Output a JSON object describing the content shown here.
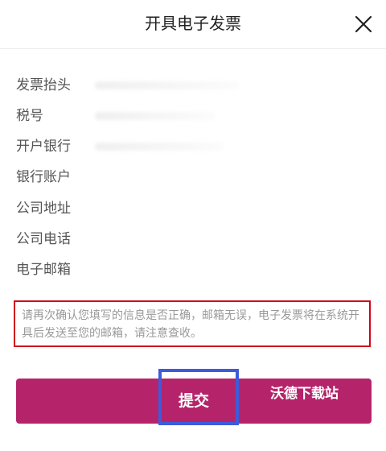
{
  "header": {
    "title": "开具电子发票",
    "close_icon": "close-icon"
  },
  "fields": [
    {
      "label": "发票抬头"
    },
    {
      "label": "税号"
    },
    {
      "label": "开户银行"
    },
    {
      "label": "银行账户"
    },
    {
      "label": "公司地址"
    },
    {
      "label": "公司电话"
    },
    {
      "label": "电子邮箱"
    }
  ],
  "notice": {
    "text": "请再次确认您填写的信息是否正确，邮箱无误，电子发票将在系统开具后发送至您的邮箱，请注意查收。"
  },
  "submit": {
    "label": "提交"
  },
  "watermark": {
    "text": "沃德下载站"
  },
  "colors": {
    "accent": "#b5246a",
    "notice_border": "#d0021b",
    "highlight": "#3e5bdc",
    "notice_text": "#999999"
  }
}
